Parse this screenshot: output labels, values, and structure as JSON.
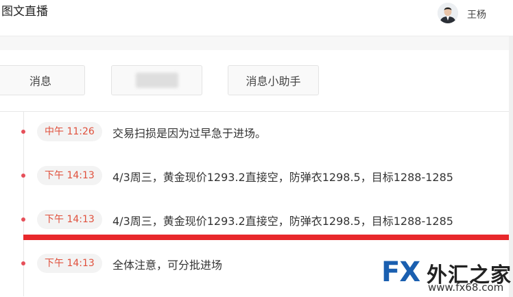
{
  "header": {
    "title": "图文直播",
    "user_name": "王杨"
  },
  "tabs": [
    {
      "label": "消息"
    },
    {
      "label": ""
    },
    {
      "label": "消息小助手"
    }
  ],
  "messages": [
    {
      "time": "中午 11:26",
      "text": "交易扫损是因为过早急于进场。"
    },
    {
      "time": "下午 14:13",
      "text": "4/3周三，黄金现价1293.2直接空，防弹衣1298.5，目标1288-1285"
    },
    {
      "time": "下午 14:13",
      "text": "4/3周三，黄金现价1293.2直接空，防弹衣1298.5，目标1288-1285"
    },
    {
      "time": "下午 14:13",
      "text": "全体注意，可分批进场"
    }
  ],
  "watermark": {
    "brand": "FX",
    "name": "外汇之家",
    "url": "www.fx68.com"
  },
  "colors": {
    "accent_red": "#e8282b",
    "time_text": "#e0503c",
    "brand_blue": "#1a5fb0"
  }
}
